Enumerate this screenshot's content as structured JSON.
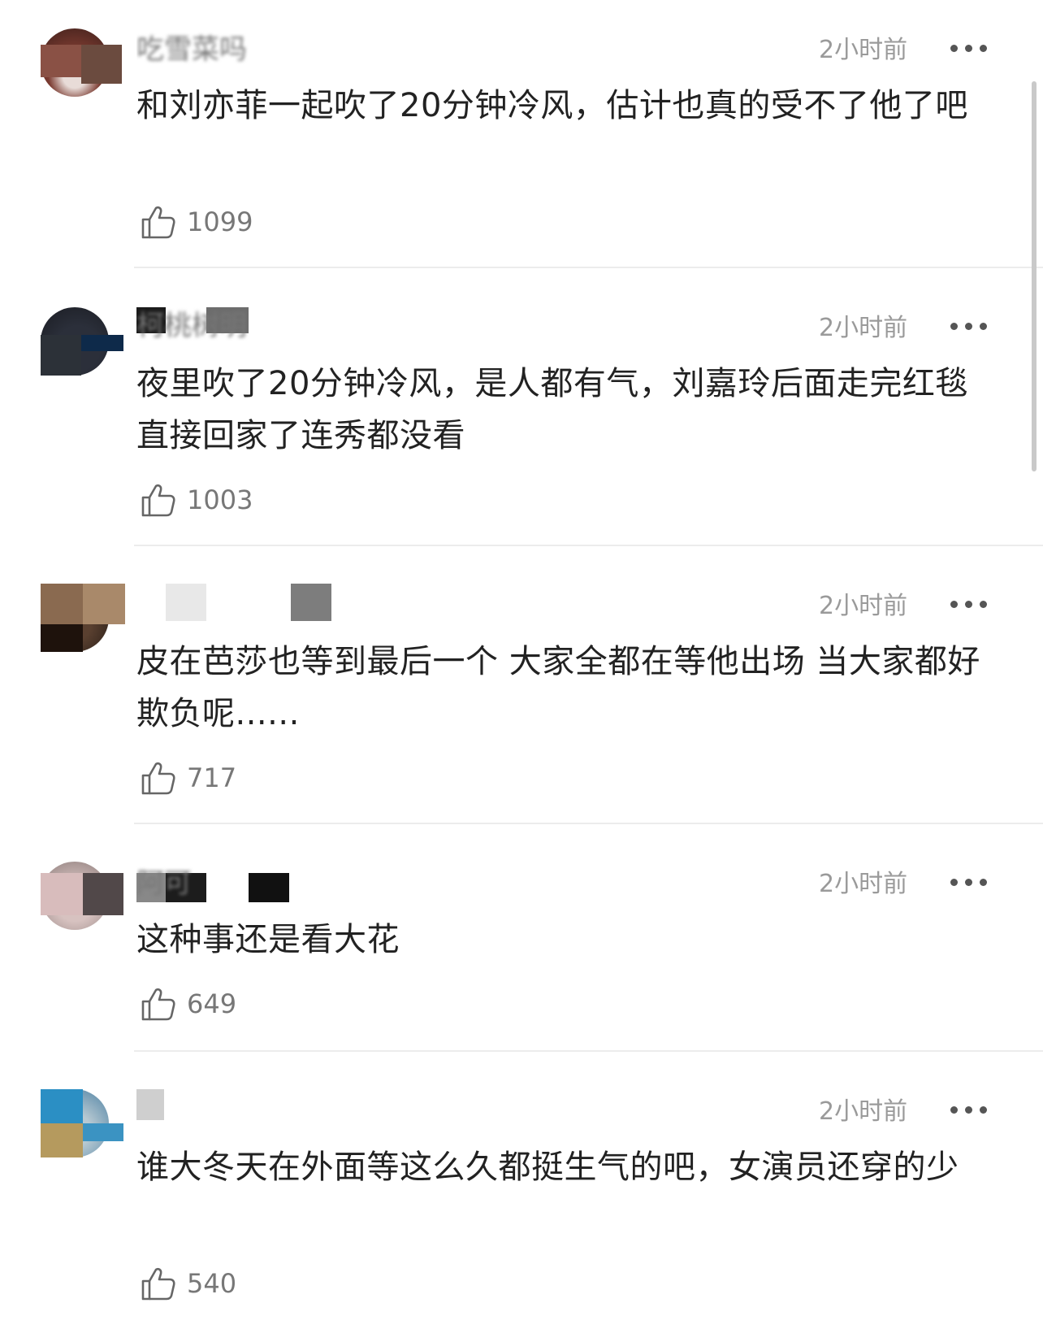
{
  "comments": [
    {
      "username": "吃雪菜吗",
      "time": "2小时前",
      "content": "和刘亦菲一起吹了20分钟冷风，估计也真的受不了他了吧",
      "likes": "1099"
    },
    {
      "username": "柯桃树明",
      "time": "2小时前",
      "content": "夜里吹了20分钟冷风，是人都有气，刘嘉玲后面走完红毯直接回家了连秀都没看",
      "likes": "1003"
    },
    {
      "username": "",
      "time": "2小时前",
      "content": "皮在芭莎也等到最后一个 大家全都在等他出场 当大家都好欺负呢......",
      "likes": "717"
    },
    {
      "username": "阿可",
      "time": "2小时前",
      "content": "这种事还是看大花",
      "likes": "649"
    },
    {
      "username": "",
      "time": "2小时前",
      "content": "谁大冬天在外面等这么久都挺生气的吧，女演员还穿的少",
      "likes": "540"
    }
  ],
  "icons": {
    "like": "thumbs-up-icon",
    "more": "more-dots-icon"
  },
  "colors": {
    "text": "#222222",
    "meta": "#9a9a9a",
    "divider": "#ececec"
  }
}
